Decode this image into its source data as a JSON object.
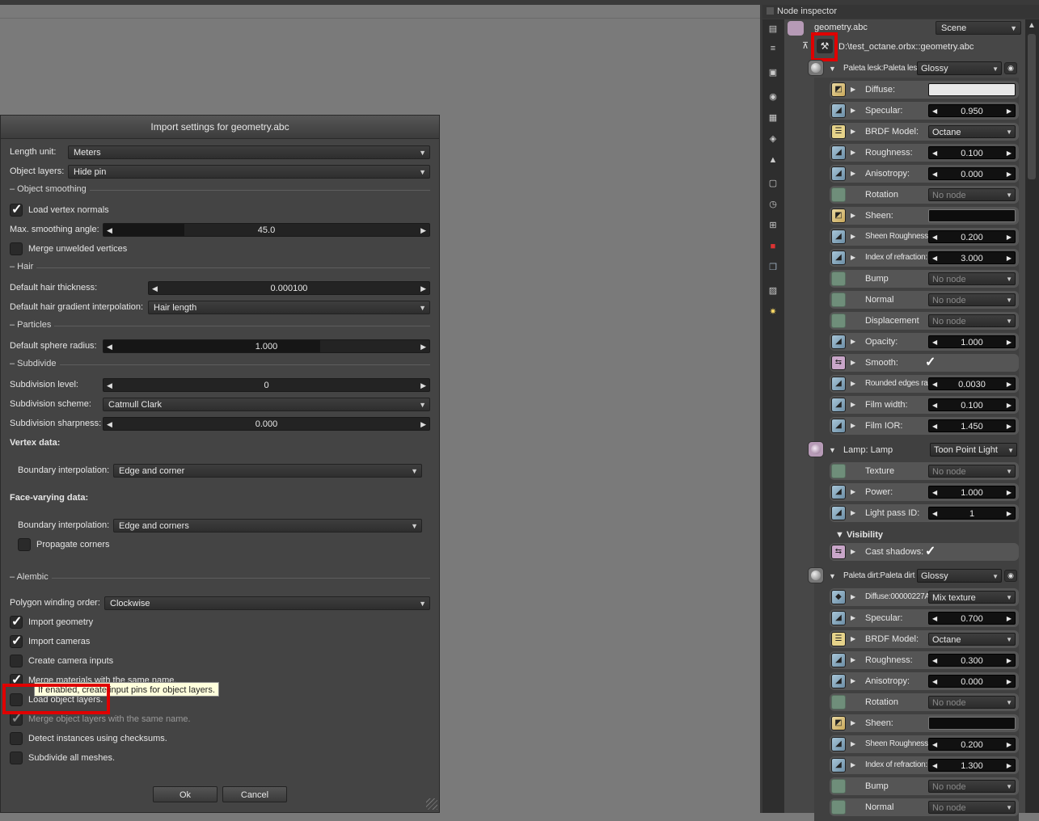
{
  "dialog": {
    "title": "Import settings for geometry.abc",
    "length_unit": {
      "label": "Length unit:",
      "value": "Meters"
    },
    "object_layers": {
      "label": "Object layers:",
      "value": "Hide pin"
    },
    "section_object_smoothing": "– Object smoothing",
    "load_vertex_normals": {
      "label": "Load vertex normals",
      "checked": true
    },
    "max_smoothing_angle": {
      "label": "Max. smoothing angle:",
      "value": "45.0"
    },
    "merge_unwelded": {
      "label": "Merge unwelded vertices",
      "checked": false
    },
    "section_hair": "– Hair",
    "default_hair_thickness": {
      "label": "Default hair thickness:",
      "value": "0.000100"
    },
    "hair_gradient": {
      "label": "Default hair gradient interpolation:",
      "value": "Hair length"
    },
    "section_particles": "– Particles",
    "sphere_radius": {
      "label": "Default sphere radius:",
      "value": "1.000"
    },
    "section_subdivide": "– Subdivide",
    "subdivision_level": {
      "label": "Subdivision level:",
      "value": "0"
    },
    "subdivision_scheme": {
      "label": "Subdivision scheme:",
      "value": "Catmull Clark"
    },
    "subdivision_sharpness": {
      "label": "Subdivision sharpness:",
      "value": "0.000"
    },
    "vertex_data": "Vertex data:",
    "vertex_boundary": {
      "label": "Boundary interpolation:",
      "value": "Edge and corner"
    },
    "face_varying_data": "Face-varying data:",
    "face_boundary": {
      "label": "Boundary interpolation:",
      "value": "Edge and corners"
    },
    "propagate_corners": {
      "label": "Propagate corners",
      "checked": false
    },
    "section_alembic": "– Alembic",
    "polygon_winding": {
      "label": "Polygon winding order:",
      "value": "Clockwise"
    },
    "import_geometry": {
      "label": "Import geometry",
      "checked": true
    },
    "import_cameras": {
      "label": "Import cameras",
      "checked": true
    },
    "create_camera_inputs": {
      "label": "Create camera inputs",
      "checked": false
    },
    "merge_materials": {
      "label": "Merge materials with the same name.",
      "checked": true
    },
    "tooltip": "If enabled, create input pins for object layers.",
    "load_object_layers": {
      "label": "Load object layers.",
      "checked": false
    },
    "merge_object_layers": {
      "label": "Merge object layers with the same name.",
      "checked": true
    },
    "detect_instances": {
      "label": "Detect instances using checksums.",
      "checked": false
    },
    "subdivide_all": {
      "label": "Subdivide all meshes.",
      "checked": false
    },
    "ok": "Ok",
    "cancel": "Cancel"
  },
  "inspector": {
    "title": "Node inspector",
    "node_name": "geometry.abc",
    "scene_combo": "Scene",
    "path": "D:\\test_octane.orbx::geometry.abc",
    "tools": [
      "layers-icon",
      "list-icon",
      "image-icon",
      "camera-icon",
      "database-icon",
      "render-icon",
      "shapes-icon",
      "frame-icon",
      "clock-icon",
      "grid-icon",
      "red-cube-icon",
      "stack-icon",
      "picture-icon",
      "sun-icon"
    ],
    "mat1": {
      "name": "Paleta lesk:Paleta lesk",
      "type": "Glossy",
      "rows": [
        {
          "name": "Diffuse:",
          "kind": "white"
        },
        {
          "name": "Specular:",
          "kind": "slider",
          "value": "0.950"
        },
        {
          "name": "BRDF Model:",
          "kind": "combo",
          "value": "Octane"
        },
        {
          "name": "Roughness:",
          "kind": "slider",
          "value": "0.100"
        },
        {
          "name": "Anisotropy:",
          "kind": "slider",
          "value": "0.000"
        },
        {
          "name": "Rotation",
          "kind": "nonode",
          "value": "No node"
        },
        {
          "name": "Sheen:",
          "kind": "black"
        },
        {
          "name": "Sheen Roughness:",
          "kind": "slider",
          "value": "0.200"
        },
        {
          "name": "Index of refraction:",
          "kind": "slider",
          "value": "3.000"
        },
        {
          "name": "Bump",
          "kind": "nonode",
          "value": "No node"
        },
        {
          "name": "Normal",
          "kind": "nonode",
          "value": "No node"
        },
        {
          "name": "Displacement",
          "kind": "nonode",
          "value": "No node"
        },
        {
          "name": "Opacity:",
          "kind": "slider",
          "value": "1.000"
        },
        {
          "name": "Smooth:",
          "kind": "check"
        },
        {
          "name": "Rounded edges ra...",
          "kind": "slider",
          "value": "0.0030"
        },
        {
          "name": "Film width:",
          "kind": "slider",
          "value": "0.100"
        },
        {
          "name": "Film IOR:",
          "kind": "slider",
          "value": "1.450"
        }
      ]
    },
    "lamp": {
      "name": "Lamp: Lamp",
      "type": "Toon Point Light",
      "rows": [
        {
          "name": "Texture",
          "kind": "nonode",
          "value": "No node"
        },
        {
          "name": "Power:",
          "kind": "slider",
          "value": "1.000"
        },
        {
          "name": "Light pass ID:",
          "kind": "slider",
          "value": "1"
        }
      ],
      "visibility": "Visibility",
      "cast_shadows": "Cast shadows:"
    },
    "mat2": {
      "name": "Paleta dirt:Paleta dirt",
      "type": "Glossy",
      "rows": [
        {
          "name": "Diffuse:00000227A...",
          "kind": "combo",
          "value": "Mix texture"
        },
        {
          "name": "Specular:",
          "kind": "slider",
          "value": "0.700"
        },
        {
          "name": "BRDF Model:",
          "kind": "combo",
          "value": "Octane"
        },
        {
          "name": "Roughness:",
          "kind": "slider",
          "value": "0.300"
        },
        {
          "name": "Anisotropy:",
          "kind": "slider",
          "value": "0.000"
        },
        {
          "name": "Rotation",
          "kind": "nonode",
          "value": "No node"
        },
        {
          "name": "Sheen:",
          "kind": "black"
        },
        {
          "name": "Sheen Roughness:",
          "kind": "slider",
          "value": "0.200"
        },
        {
          "name": "Index of refraction:",
          "kind": "slider",
          "value": "1.300"
        },
        {
          "name": "Bump",
          "kind": "nonode",
          "value": "No node"
        },
        {
          "name": "Normal",
          "kind": "nonode",
          "value": "No node"
        }
      ]
    }
  }
}
